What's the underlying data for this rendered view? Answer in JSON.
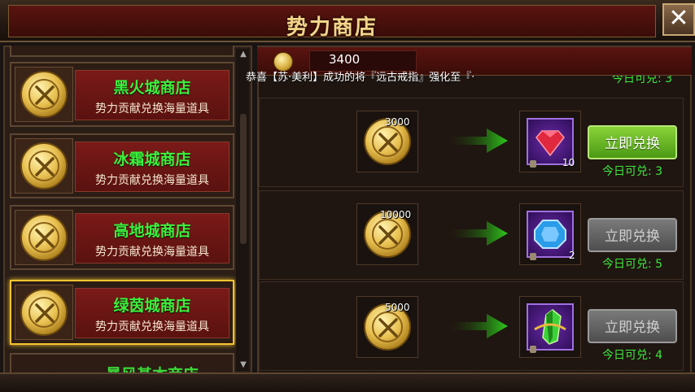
{
  "window": {
    "title": "势力商店",
    "close_label": "✕"
  },
  "currency": {
    "value": "3400",
    "icon": "gold-coin-icon"
  },
  "broadcast": {
    "text": "恭喜【苏·美利】成功的将『远古戒指』强化至『·"
  },
  "header_partial": {
    "limit_text": "今日可兑: 3"
  },
  "shops": [
    {
      "name": "黑火城商店",
      "desc": "势力贡献兑换海量道具",
      "selected": false
    },
    {
      "name": "冰霜城商店",
      "desc": "势力贡献兑换海量道具",
      "selected": false
    },
    {
      "name": "高地城商店",
      "desc": "势力贡献兑换海量道具",
      "selected": false
    },
    {
      "name": "绿茵城商店",
      "desc": "势力贡献兑换海量道具",
      "selected": true
    }
  ],
  "shop_partial_bottom": {
    "name": "暴风基本商店"
  },
  "exchanges": [
    {
      "cost": "3000",
      "reward_icon": "red-ruby-gem-icon",
      "reward_count": "10",
      "button_label": "立即兑换",
      "button_enabled": true,
      "limit_text": "今日可兑: 3"
    },
    {
      "cost": "10000",
      "reward_icon": "blue-sapphire-gem-icon",
      "reward_count": "2",
      "button_label": "立即兑换",
      "button_enabled": false,
      "limit_text": "今日可兑: 5"
    },
    {
      "cost": "5000",
      "reward_icon": "green-crystal-icon",
      "reward_count": "",
      "button_label": "立即兑换",
      "button_enabled": false,
      "limit_text": "今日可兑: 4"
    }
  ],
  "colors": {
    "accent_green": "#3cf03c",
    "title_gold": "#f2d58a",
    "button_green": "#6ab82a",
    "button_gray": "#6a6a6a"
  }
}
